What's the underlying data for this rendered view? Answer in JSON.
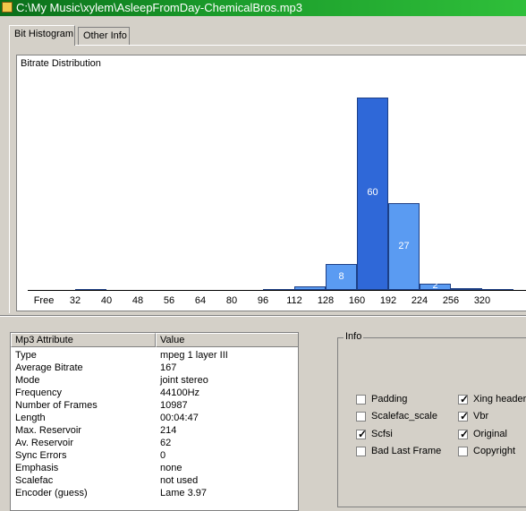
{
  "window": {
    "title": "C:\\My Music\\xylem\\AsleepFromDay-ChemicalBros.mp3"
  },
  "tabs": [
    {
      "label": "Bit Histogram",
      "active": true
    },
    {
      "label": "Other Info",
      "active": false
    }
  ],
  "chart_data": {
    "type": "bar",
    "title": "Bitrate Distribution",
    "categories": [
      "Free",
      "32",
      "40",
      "48",
      "56",
      "64",
      "80",
      "96",
      "112",
      "128",
      "160",
      "192",
      "224",
      "256",
      "320"
    ],
    "values": [
      0,
      0.3,
      0,
      0,
      0,
      0,
      0,
      0.3,
      1,
      8,
      60,
      27,
      2,
      0.6,
      0.3
    ],
    "data_labels": [
      "",
      "",
      "",
      "",
      "",
      "",
      "",
      "",
      "",
      "8",
      "60",
      "27",
      "2",
      "",
      ""
    ],
    "highlight_index": 10,
    "ylim": [
      0,
      65
    ],
    "colors": {
      "normal": "#5a9bf2",
      "highlight": "#2f68d8"
    }
  },
  "attributes": {
    "headers": {
      "attr": "Mp3 Attribute",
      "value": "Value"
    },
    "rows": [
      {
        "attr": "Type",
        "value": "mpeg 1 layer III"
      },
      {
        "attr": "Average Bitrate",
        "value": "167"
      },
      {
        "attr": "Mode",
        "value": "joint stereo"
      },
      {
        "attr": "Frequency",
        "value": "44100Hz"
      },
      {
        "attr": "Number of Frames",
        "value": "10987"
      },
      {
        "attr": "Length",
        "value": "00:04:47"
      },
      {
        "attr": "Max. Reservoir",
        "value": "214"
      },
      {
        "attr": "Av. Reservoir",
        "value": "62"
      },
      {
        "attr": "Sync Errors",
        "value": "0"
      },
      {
        "attr": "Emphasis",
        "value": "none"
      },
      {
        "attr": "Scalefac",
        "value": "not used"
      },
      {
        "attr": "Encoder (guess)",
        "value": "Lame 3.97"
      }
    ]
  },
  "info": {
    "title": "Info",
    "checkboxes": [
      {
        "label": "Padding",
        "checked": false
      },
      {
        "label": "Scalefac_scale",
        "checked": false
      },
      {
        "label": "Scfsi",
        "checked": true
      },
      {
        "label": "Bad Last Frame",
        "checked": false
      },
      {
        "label": "Xing header",
        "checked": true
      },
      {
        "label": "Vbr",
        "checked": true
      },
      {
        "label": "Original",
        "checked": true
      },
      {
        "label": "Copyright",
        "checked": false
      }
    ]
  }
}
